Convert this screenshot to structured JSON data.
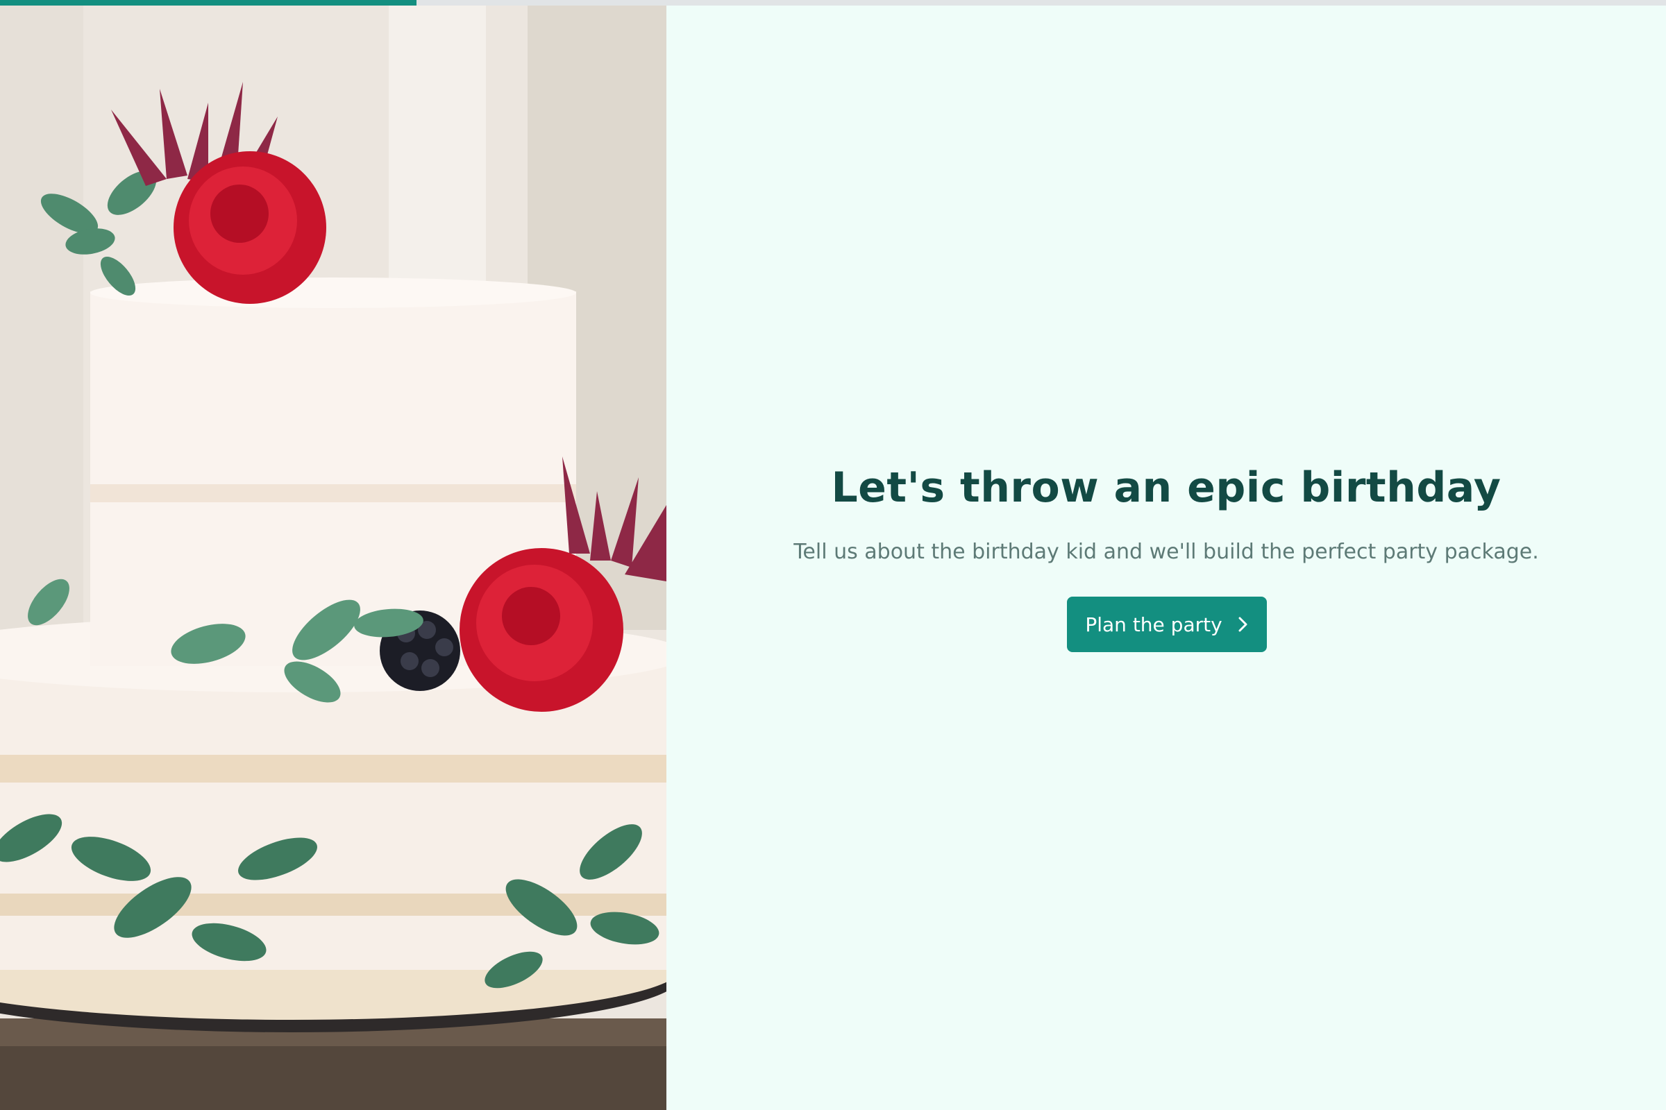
{
  "progress": {
    "fraction": 0.25
  },
  "hero": {
    "image": "cake-photo",
    "icon": "two-tier-cake-with-red-flowers"
  },
  "main": {
    "title": "Let's throw an epic birthday",
    "subtitle": "Tell us about the birthday kid and we'll build the perfect party package.",
    "cta_label": "Plan the party",
    "cta_icon": "chevron-right-icon"
  },
  "colors": {
    "accent": "#138f80",
    "background": "#effdf9",
    "title": "#134a44",
    "subtitle": "#5d7a76"
  }
}
